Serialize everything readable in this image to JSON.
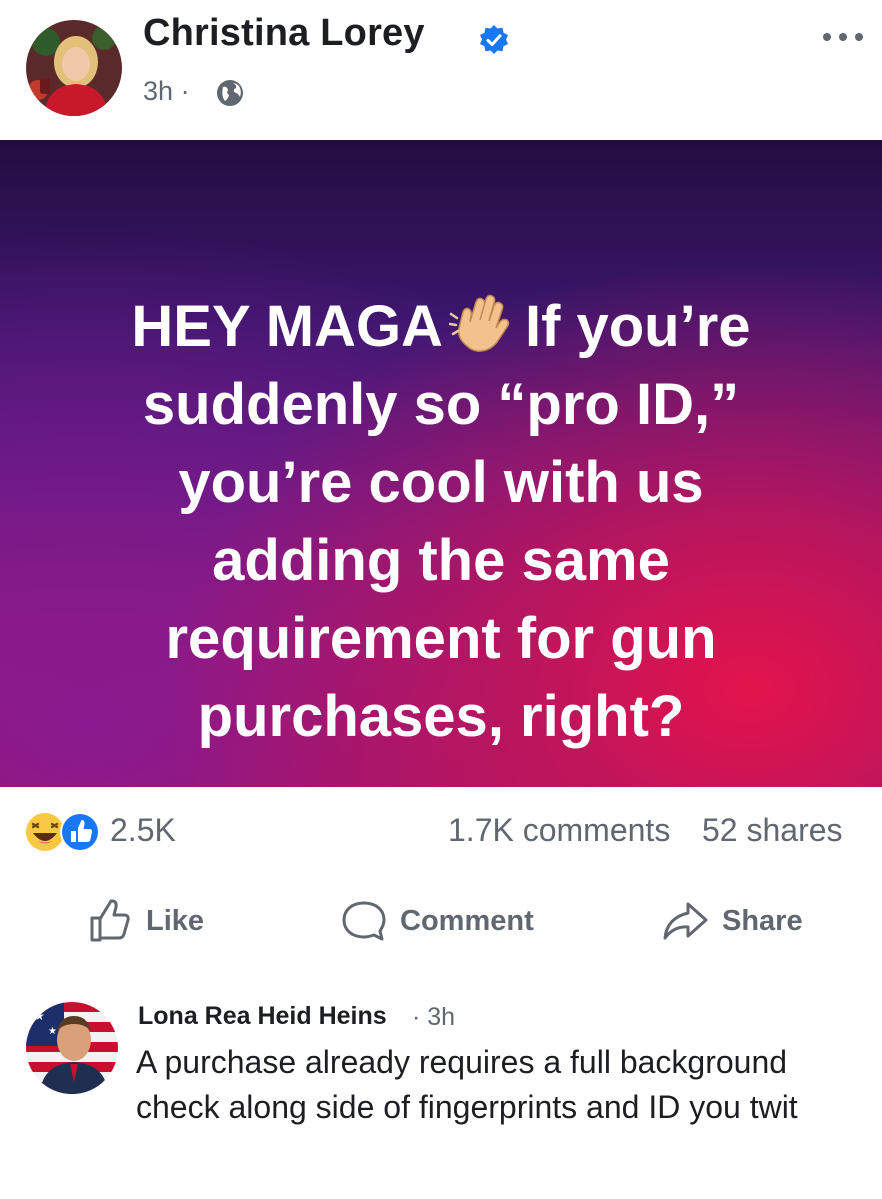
{
  "post": {
    "author": "Christina Lorey",
    "time": "3h",
    "time_separator": "·",
    "image_text_lines": [
      [
        "HEY MAGA",
        "If you’re"
      ],
      [
        "suddenly so “pro ID,”"
      ],
      [
        "you’re cool with us"
      ],
      [
        "adding the same"
      ],
      [
        "requirement for gun"
      ],
      [
        "purchases, right?"
      ]
    ],
    "icons": {
      "verified": "verified-badge-icon",
      "audience": "globe-icon",
      "menu": "more-options-icon",
      "wave": "waving-hand-emoji"
    }
  },
  "stats": {
    "reactions_count": "2.5K",
    "comments": "1.7K comments",
    "shares": "52 shares",
    "reaction_icons": [
      "haha-reaction-icon",
      "like-reaction-icon"
    ]
  },
  "actions": {
    "like": "Like",
    "comment": "Comment",
    "share": "Share"
  },
  "comment": {
    "author": "Lona Rea Heid Heins",
    "time": "· 3h",
    "text": "A purchase already requires a full background check along side of fingerprints and ID you twit"
  },
  "colors": {
    "verified_blue": "#1877f2",
    "secondary_text": "#606770",
    "primary_text": "#1c1e21",
    "haha_yellow": "#f7c843"
  }
}
